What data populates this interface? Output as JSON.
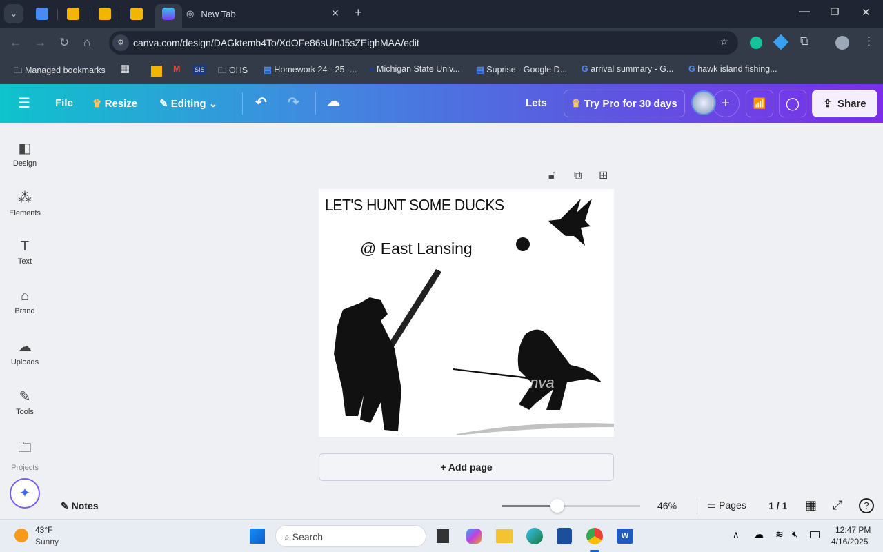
{
  "browser": {
    "tabs": [
      {
        "label": "New Tab",
        "icon": "chrome-icon"
      }
    ],
    "url": "canva.com/design/DAGktemb4To/XdOFe86sUlnJ5sZEighMAA/edit",
    "bookmarks": [
      "Managed bookmarks",
      "OHS",
      "Homework 24 - 25 -...",
      "Michigan State Univ...",
      "Suprise - Google D...",
      "arrival summary - G...",
      "hawk island fishing..."
    ],
    "sis": "SIS"
  },
  "header": {
    "file": "File",
    "resize": "Resize",
    "editing": "Editing",
    "title": "Lets",
    "try_pro": "Try Pro for 30 days",
    "share": "Share"
  },
  "sidebar": [
    {
      "label": "Design"
    },
    {
      "label": "Elements"
    },
    {
      "label": "Text"
    },
    {
      "label": "Brand"
    },
    {
      "label": "Uploads"
    },
    {
      "label": "Tools"
    },
    {
      "label": "Projects"
    }
  ],
  "design": {
    "headline": "LET'S HUNT SOME DUCKS",
    "location": "@ East Lansing",
    "watermark": "Canva"
  },
  "add_page": "+ Add page",
  "footer": {
    "notes": "Notes",
    "zoom": "46%",
    "zoom_fraction": 0.4,
    "pages": "Pages",
    "page_count": "1 / 1"
  },
  "taskbar": {
    "temp": "43°F",
    "weather": "Sunny",
    "search": "Search",
    "time": "12:47 PM",
    "date": "4/16/2025"
  }
}
